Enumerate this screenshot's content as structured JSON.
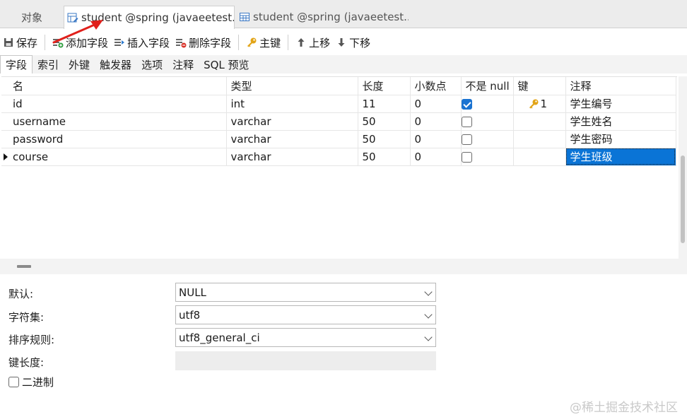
{
  "tabs": [
    {
      "label": "对象"
    },
    {
      "label": "student @spring (javaeetest..."
    },
    {
      "label": "student @spring (javaeetest..."
    }
  ],
  "toolbar": {
    "save": "保存",
    "add_field": "添加字段",
    "insert_field": "插入字段",
    "delete_field": "删除字段",
    "primary_key": "主键",
    "move_up": "上移",
    "move_down": "下移"
  },
  "subtabs": [
    "字段",
    "索引",
    "外键",
    "触发器",
    "选项",
    "注释",
    "SQL 预览"
  ],
  "grid": {
    "headers": [
      "名",
      "类型",
      "长度",
      "小数点",
      "不是 null",
      "键",
      "注释"
    ],
    "rows": [
      {
        "name": "id",
        "type": "int",
        "length": "11",
        "decimals": "0",
        "not_null": true,
        "key": "1",
        "comment": "学生编号"
      },
      {
        "name": "username",
        "type": "varchar",
        "length": "50",
        "decimals": "0",
        "not_null": false,
        "key": "",
        "comment": "学生姓名"
      },
      {
        "name": "password",
        "type": "varchar",
        "length": "50",
        "decimals": "0",
        "not_null": false,
        "key": "",
        "comment": "学生密码"
      },
      {
        "name": "course",
        "type": "varchar",
        "length": "50",
        "decimals": "0",
        "not_null": false,
        "key": "",
        "comment": "学生班级"
      }
    ]
  },
  "props": {
    "default_label": "默认:",
    "default_value": "NULL",
    "charset_label": "字符集:",
    "charset_value": "utf8",
    "collation_label": "排序规则:",
    "collation_value": "utf8_general_ci",
    "key_length_label": "键长度:",
    "binary_label": "二进制"
  },
  "watermark": "@稀土掘金技术社区",
  "colors": {
    "selection": "#0a74d6",
    "checkbox": "#1a73d1",
    "annotation": "#e0201b"
  }
}
